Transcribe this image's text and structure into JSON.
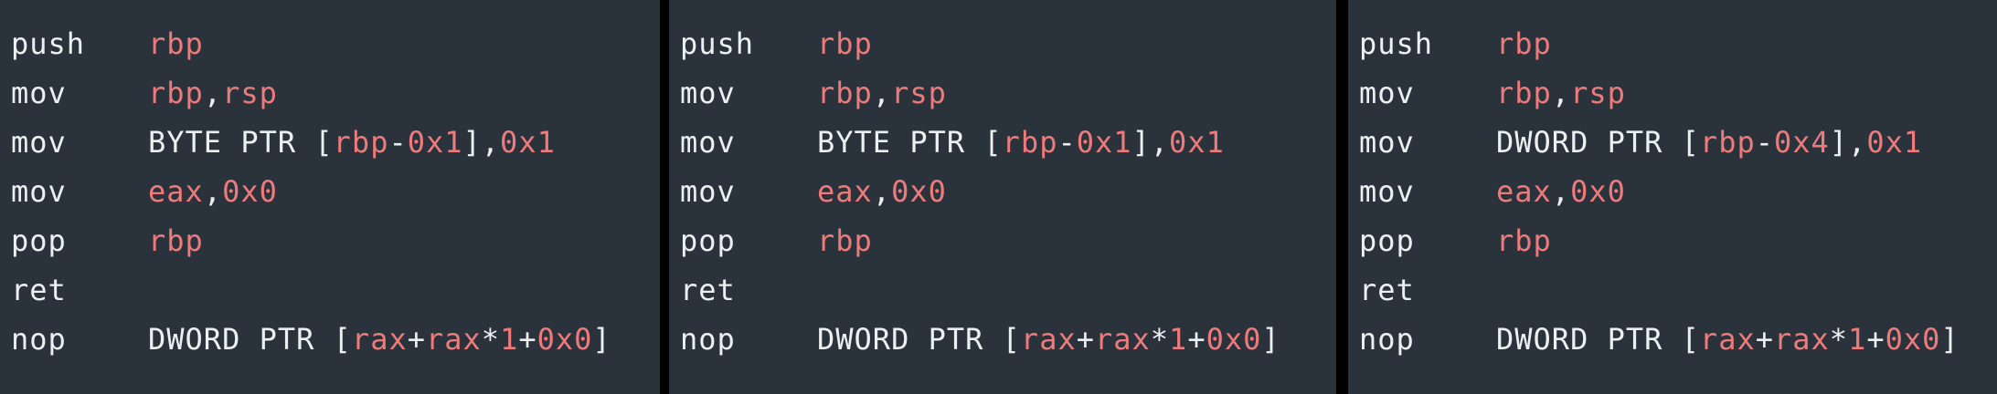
{
  "colors": {
    "background": "#2a333b",
    "divider": "#000000",
    "plain_text": "#ecf0f1",
    "highlight": "#ee7b7b"
  },
  "panels": [
    {
      "lines": [
        {
          "mnemonic": "push",
          "tokens": [
            {
              "t": "rbp",
              "c": "reg"
            }
          ]
        },
        {
          "mnemonic": "mov",
          "tokens": [
            {
              "t": "rbp",
              "c": "reg"
            },
            {
              "t": ",",
              "c": "plain"
            },
            {
              "t": "rsp",
              "c": "reg"
            }
          ]
        },
        {
          "mnemonic": "mov",
          "tokens": [
            {
              "t": "BYTE PTR [",
              "c": "plain"
            },
            {
              "t": "rbp",
              "c": "reg"
            },
            {
              "t": "-",
              "c": "plain"
            },
            {
              "t": "0x1",
              "c": "reg"
            },
            {
              "t": "],",
              "c": "plain"
            },
            {
              "t": "0x1",
              "c": "reg"
            }
          ]
        },
        {
          "mnemonic": "mov",
          "tokens": [
            {
              "t": "eax",
              "c": "reg"
            },
            {
              "t": ",",
              "c": "plain"
            },
            {
              "t": "0x0",
              "c": "reg"
            }
          ]
        },
        {
          "mnemonic": "pop",
          "tokens": [
            {
              "t": "rbp",
              "c": "reg"
            }
          ]
        },
        {
          "mnemonic": "ret",
          "tokens": []
        },
        {
          "mnemonic": "nop",
          "tokens": [
            {
              "t": "DWORD PTR [",
              "c": "plain"
            },
            {
              "t": "rax",
              "c": "reg"
            },
            {
              "t": "+",
              "c": "plain"
            },
            {
              "t": "rax",
              "c": "reg"
            },
            {
              "t": "*",
              "c": "plain"
            },
            {
              "t": "1",
              "c": "reg"
            },
            {
              "t": "+",
              "c": "plain"
            },
            {
              "t": "0x0",
              "c": "reg"
            },
            {
              "t": "]",
              "c": "plain"
            }
          ]
        }
      ]
    },
    {
      "lines": [
        {
          "mnemonic": "push",
          "tokens": [
            {
              "t": "rbp",
              "c": "reg"
            }
          ]
        },
        {
          "mnemonic": "mov",
          "tokens": [
            {
              "t": "rbp",
              "c": "reg"
            },
            {
              "t": ",",
              "c": "plain"
            },
            {
              "t": "rsp",
              "c": "reg"
            }
          ]
        },
        {
          "mnemonic": "mov",
          "tokens": [
            {
              "t": "BYTE PTR [",
              "c": "plain"
            },
            {
              "t": "rbp",
              "c": "reg"
            },
            {
              "t": "-",
              "c": "plain"
            },
            {
              "t": "0x1",
              "c": "reg"
            },
            {
              "t": "],",
              "c": "plain"
            },
            {
              "t": "0x1",
              "c": "reg"
            }
          ]
        },
        {
          "mnemonic": "mov",
          "tokens": [
            {
              "t": "eax",
              "c": "reg"
            },
            {
              "t": ",",
              "c": "plain"
            },
            {
              "t": "0x0",
              "c": "reg"
            }
          ]
        },
        {
          "mnemonic": "pop",
          "tokens": [
            {
              "t": "rbp",
              "c": "reg"
            }
          ]
        },
        {
          "mnemonic": "ret",
          "tokens": []
        },
        {
          "mnemonic": "nop",
          "tokens": [
            {
              "t": "DWORD PTR [",
              "c": "plain"
            },
            {
              "t": "rax",
              "c": "reg"
            },
            {
              "t": "+",
              "c": "plain"
            },
            {
              "t": "rax",
              "c": "reg"
            },
            {
              "t": "*",
              "c": "plain"
            },
            {
              "t": "1",
              "c": "reg"
            },
            {
              "t": "+",
              "c": "plain"
            },
            {
              "t": "0x0",
              "c": "reg"
            },
            {
              "t": "]",
              "c": "plain"
            }
          ]
        }
      ]
    },
    {
      "lines": [
        {
          "mnemonic": "push",
          "tokens": [
            {
              "t": "rbp",
              "c": "reg"
            }
          ]
        },
        {
          "mnemonic": "mov",
          "tokens": [
            {
              "t": "rbp",
              "c": "reg"
            },
            {
              "t": ",",
              "c": "plain"
            },
            {
              "t": "rsp",
              "c": "reg"
            }
          ]
        },
        {
          "mnemonic": "mov",
          "tokens": [
            {
              "t": "DWORD PTR [",
              "c": "plain"
            },
            {
              "t": "rbp",
              "c": "reg"
            },
            {
              "t": "-",
              "c": "plain"
            },
            {
              "t": "0x4",
              "c": "reg"
            },
            {
              "t": "],",
              "c": "plain"
            },
            {
              "t": "0x1",
              "c": "reg"
            }
          ]
        },
        {
          "mnemonic": "mov",
          "tokens": [
            {
              "t": "eax",
              "c": "reg"
            },
            {
              "t": ",",
              "c": "plain"
            },
            {
              "t": "0x0",
              "c": "reg"
            }
          ]
        },
        {
          "mnemonic": "pop",
          "tokens": [
            {
              "t": "rbp",
              "c": "reg"
            }
          ]
        },
        {
          "mnemonic": "ret",
          "tokens": []
        },
        {
          "mnemonic": "nop",
          "tokens": [
            {
              "t": "DWORD PTR [",
              "c": "plain"
            },
            {
              "t": "rax",
              "c": "reg"
            },
            {
              "t": "+",
              "c": "plain"
            },
            {
              "t": "rax",
              "c": "reg"
            },
            {
              "t": "*",
              "c": "plain"
            },
            {
              "t": "1",
              "c": "reg"
            },
            {
              "t": "+",
              "c": "plain"
            },
            {
              "t": "0x0",
              "c": "reg"
            },
            {
              "t": "]",
              "c": "plain"
            }
          ]
        }
      ]
    }
  ]
}
